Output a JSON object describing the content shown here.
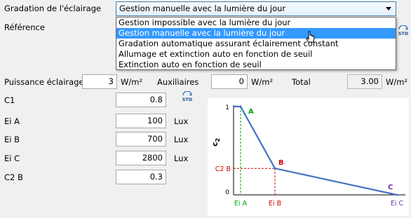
{
  "gradation": {
    "label": "Gradation de l'éclairage",
    "selected": "Gestion manuelle avec la lumière du jour",
    "options": [
      "Gestion impossible avec la lumière du jour",
      "Gestion manuelle avec la lumière du jour",
      "Gradation automatique assurant éclairement constant",
      "Allumage et extinction auto en fonction de seuil",
      "Extinction auto en fonction de seuil"
    ],
    "highlighted_index": 1
  },
  "reference": {
    "label": "Référence",
    "std_icon": "STD"
  },
  "puissance": {
    "label": "Puissance éclairage",
    "value": "3",
    "unit": "W/m²"
  },
  "auxiliaires": {
    "label": "Auxiliaires",
    "value": "0",
    "unit": "W/m²"
  },
  "total": {
    "label": "Total",
    "value": "3.00",
    "unit": "W/m²"
  },
  "params": {
    "c1": {
      "label": "C1",
      "value": "0.8",
      "std_icon": "STD"
    },
    "eia": {
      "label": "Ei A",
      "value": "100",
      "unit": "Lux"
    },
    "eib": {
      "label": "Ei B",
      "value": "700",
      "unit": "Lux"
    },
    "eic": {
      "label": "Ei C",
      "value": "2800",
      "unit": "Lux"
    },
    "c2b": {
      "label": "C2 B",
      "value": "0.3"
    }
  },
  "colors": {
    "accent": "#3399ff",
    "line": "#4472c4",
    "green": "#00a000",
    "red": "#d00000",
    "purple": "#7030a0"
  },
  "chart_data": {
    "type": "line",
    "ylabel": "c2",
    "yticks": [
      "1",
      "C2 B",
      "0"
    ],
    "xticks": [
      "Ei A",
      "Ei B",
      "Ei C"
    ],
    "points": [
      {
        "name": "A",
        "x": 100,
        "y": 1
      },
      {
        "name": "B",
        "x": 700,
        "y": 0.3
      },
      {
        "name": "C",
        "x": 2800,
        "y": 0
      }
    ],
    "start": {
      "x": 0,
      "y": 1
    },
    "xlim": [
      0,
      2800
    ],
    "ylim": [
      0,
      1
    ]
  }
}
